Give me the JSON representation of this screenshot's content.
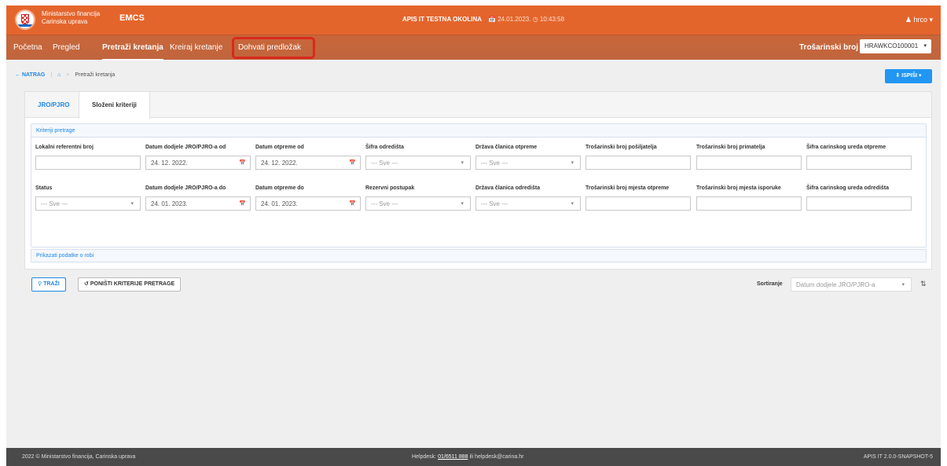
{
  "header": {
    "org_line1": "Ministarstvo financija",
    "org_line2": "Carinska uprava",
    "app_name": "EMCS",
    "environment": "APIS IT TESTNA OKOLINA",
    "date": "24.01.2023.",
    "time": "10:43:58",
    "user": "hrco",
    "brand_color": "#e4652c"
  },
  "nav": {
    "items": [
      "Početna",
      "Pregled",
      "Pretraži kretanja",
      "Kreiraj kretanje",
      "Dohvati predložak"
    ],
    "active_index": 2,
    "highlighted_index": 4,
    "excise_label": "Trošarinski broj",
    "excise_value": "HRAWKCO100001"
  },
  "breadcrumb": {
    "back": "NATRAG",
    "current": "Pretraži kretanja"
  },
  "print_button": "ISPIŠI",
  "tabs": [
    "JRO/PJRO",
    "Složeni kriteriji"
  ],
  "criteria": {
    "title": "Kriteriji pretrage",
    "row1": [
      {
        "label": "Lokalni referentni broj",
        "value": "",
        "kind": "text"
      },
      {
        "label": "Datum dodjele JRO/PJRO-a od",
        "value": "24. 12. 2022.",
        "kind": "date"
      },
      {
        "label": "Datum otpreme od",
        "value": "24. 12. 2022.",
        "kind": "date"
      },
      {
        "label": "Šifra odredišta",
        "value": "--- Sve ---",
        "kind": "select"
      },
      {
        "label": "Država članica otpreme",
        "value": "--- Sve ---",
        "kind": "select"
      },
      {
        "label": "Trošarinski broj pošiljatelja",
        "value": "",
        "kind": "text"
      },
      {
        "label": "Trošarinski broj primatelja",
        "value": "",
        "kind": "text"
      },
      {
        "label": "Šifra carinskog ureda otpreme",
        "value": "",
        "kind": "text"
      }
    ],
    "row2": [
      {
        "label": "Status",
        "value": "--- Sve ---",
        "kind": "select"
      },
      {
        "label": "Datum dodjele JRO/PJRO-a do",
        "value": "24. 01. 2023.",
        "kind": "date"
      },
      {
        "label": "Datum otpreme do",
        "value": "24. 01. 2023.",
        "kind": "date"
      },
      {
        "label": "Rezervni postupak",
        "value": "--- Sve ---",
        "kind": "select"
      },
      {
        "label": "Država članica odredišta",
        "value": "--- Sve ---",
        "kind": "select"
      },
      {
        "label": "Trošarinski broj mjesta otpreme",
        "value": "",
        "kind": "text"
      },
      {
        "label": "Trošarinski broj mjesta isporuke",
        "value": "",
        "kind": "text"
      },
      {
        "label": "Šifra carinskog ureda odredišta",
        "value": "",
        "kind": "text"
      }
    ],
    "goods_link": "Prikazati podatke o robi"
  },
  "actions": {
    "search": "TRAŽI",
    "reset": "PONIŠTI KRITERIJE PRETRAGE",
    "sort_label": "Sortiranje",
    "sort_value": "Datum dodjele JRO/PJRO-a"
  },
  "footer": {
    "copyright": "2022 © Ministarstvo financija, Carinska uprava",
    "helpdesk_label": "Helpdesk:",
    "helpdesk_phone": "01/6511 888",
    "helpdesk_rest": "ili helpdesk@carina.hr",
    "version": "APIS IT  2.0.0-SNAPSHOT-5"
  }
}
